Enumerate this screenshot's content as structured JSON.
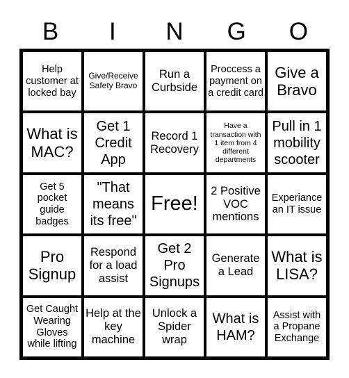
{
  "title": {
    "letters": [
      "B",
      "I",
      "N",
      "G",
      "O"
    ]
  },
  "card": {
    "rows": [
      [
        "Help customer at locked bay",
        "Give/Receive Safety Bravo",
        "Run a Curbside",
        "Proccess a payment on a credit card",
        "Give a Bravo"
      ],
      [
        "What is MAC?",
        "Get 1 Credit App",
        "Record 1 Recovery",
        "Have a transaction with 1 item from 4 different departments",
        "Pull in 1 mobility scooter"
      ],
      [
        "Get 5 pocket guide badges",
        "\"That means its free\"",
        "Free!",
        "2 Positive VOC mentions",
        "Experiance an IT issue"
      ],
      [
        "Pro Signup",
        "Respond for a load assist",
        "Get 2 Pro Signups",
        "Generate a Lead",
        "What is LISA?"
      ],
      [
        "Get Caught Wearing Gloves while lifting",
        "Help at the key machine",
        "Unlock a Spider wrap",
        "What is HAM?",
        "Assist with a Propane Exchange"
      ]
    ]
  },
  "colors": {
    "border": "#000000",
    "background": "#ffffff",
    "text": "#000000"
  }
}
